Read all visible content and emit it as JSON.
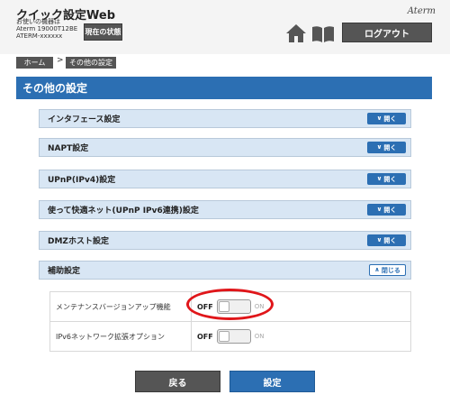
{
  "header": {
    "title": "クイック設定Web",
    "device_lines": [
      "お使いの機器は",
      "Aterm 19000T12BE",
      "ATERM-xxxxxx"
    ],
    "status_button": "現在の状態",
    "brand": "Aterm",
    "logout_button": "ログアウト"
  },
  "breadcrumb": {
    "home": "ホーム",
    "separator": ">",
    "current": "その他の設定"
  },
  "section_title": "その他の設定",
  "accordion": [
    {
      "label": "インタフェース設定",
      "button": "開く"
    },
    {
      "label": "NAPT設定",
      "button": "開く"
    },
    {
      "label": "UPnP(IPv4)設定",
      "button": "開く"
    },
    {
      "label": "使って快適ネット(UPnP IPv6連携)設定",
      "button": "開く"
    },
    {
      "label": "DMZホスト設定",
      "button": "開く"
    },
    {
      "label": "補助設定",
      "button": "閉じる"
    }
  ],
  "settings": [
    {
      "name": "メンテナンスバージョンアップ機能",
      "off": "OFF",
      "on": "ON",
      "state": "off"
    },
    {
      "name": "IPv6ネットワーク拡張オプション",
      "off": "OFF",
      "on": "ON",
      "state": "off"
    }
  ],
  "footer": {
    "back_button": "戻る",
    "apply_button": "設定"
  },
  "colors": {
    "accent": "#2c6fb3",
    "dark_button": "#555555",
    "row_bg": "#d8e6f4",
    "highlight": "#e0161a"
  }
}
